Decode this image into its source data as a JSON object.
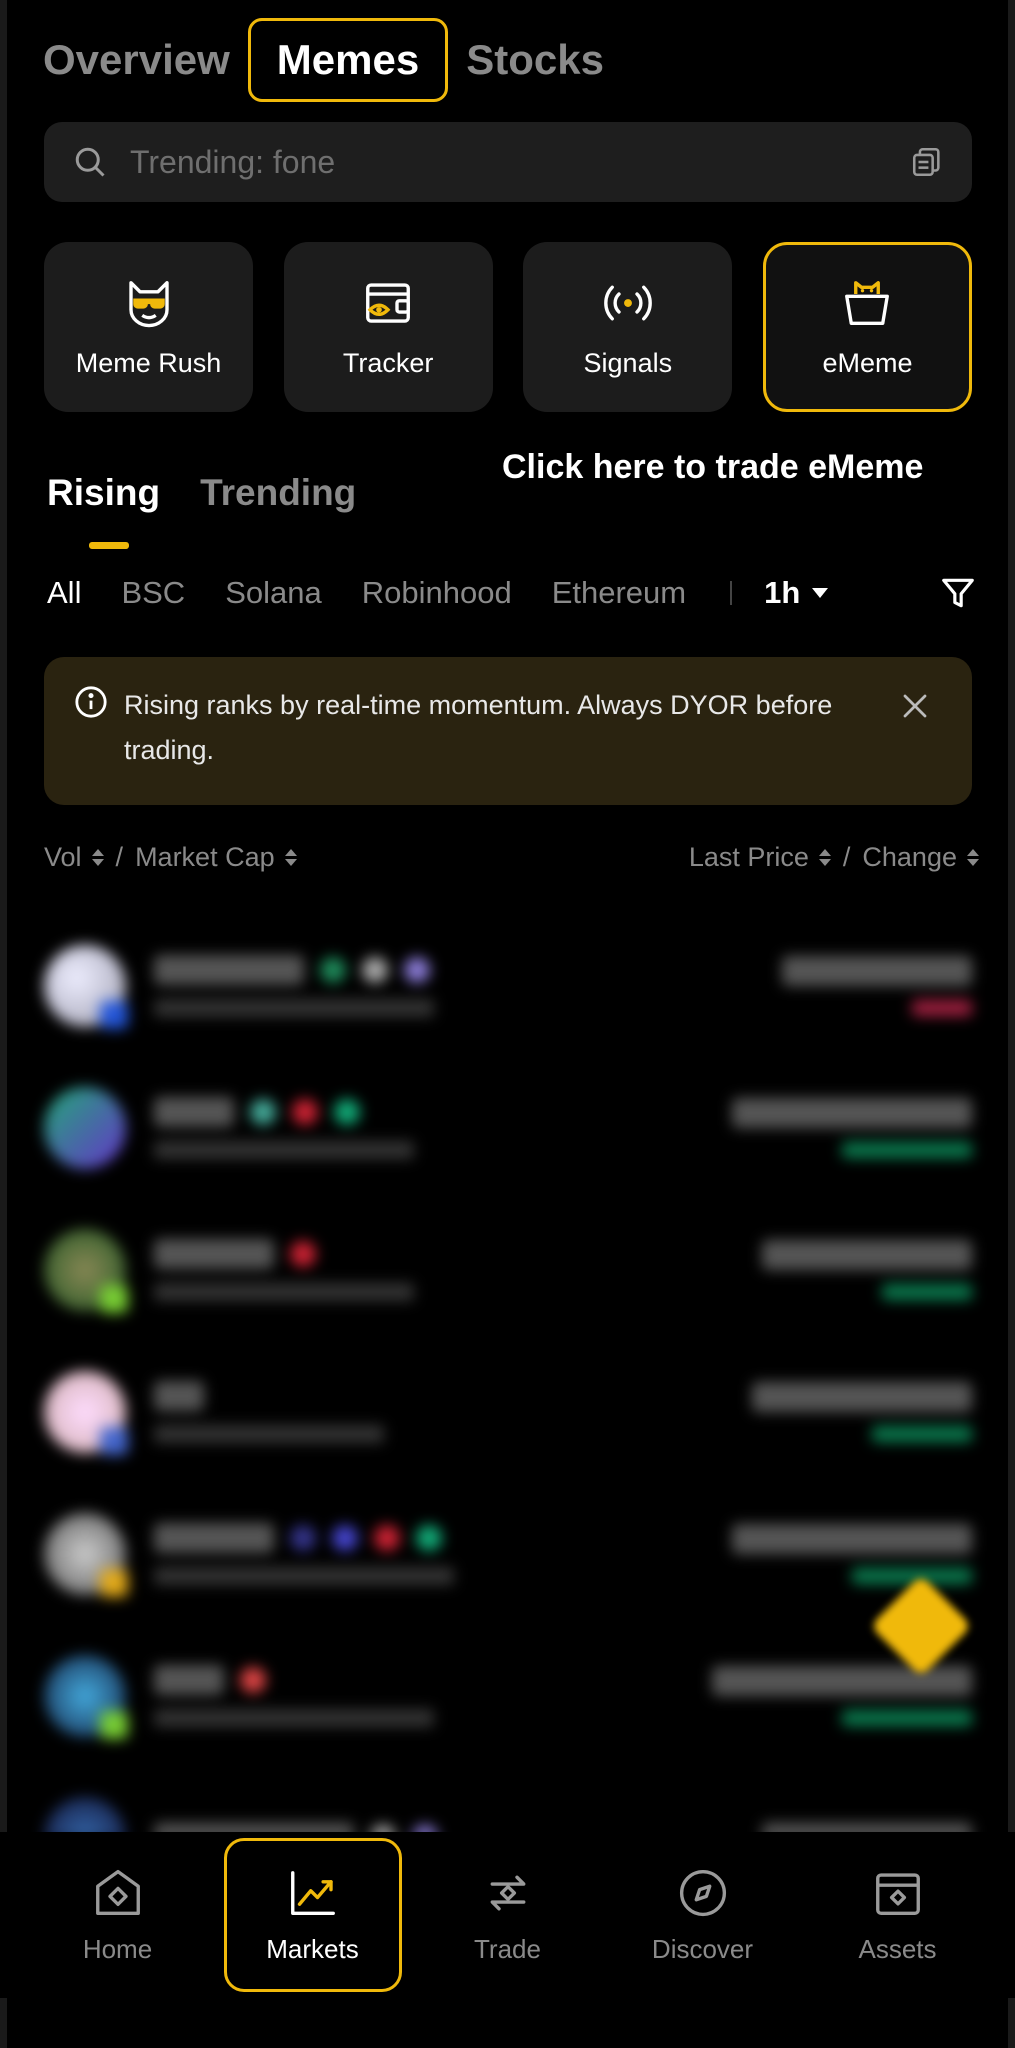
{
  "top_tabs": [
    {
      "label": "Overview",
      "active": false
    },
    {
      "label": "Memes",
      "active": true
    },
    {
      "label": "Stocks",
      "active": false
    }
  ],
  "search": {
    "placeholder": "Trending: fone"
  },
  "shortcuts": [
    {
      "label": "Meme Rush",
      "icon": "cat-sunglasses-icon"
    },
    {
      "label": "Tracker",
      "icon": "wallet-eye-icon"
    },
    {
      "label": "Signals",
      "icon": "broadcast-icon"
    },
    {
      "label": "eMeme",
      "icon": "ememe-cat-icon"
    }
  ],
  "hint": "Click here to trade eMeme",
  "sub_tabs": [
    {
      "label": "Rising",
      "active": true
    },
    {
      "label": "Trending",
      "active": false
    }
  ],
  "chains": [
    "All",
    "BSC",
    "Solana",
    "Robinhood",
    "Ethereum"
  ],
  "timeframe": "1h",
  "notice": "Rising ranks by real-time momentum. Always DYOR before trading.",
  "columns": {
    "vol": "Vol",
    "divider": "/",
    "market_cap": "Market Cap",
    "last_price": "Last Price",
    "change": "Change"
  },
  "colors": {
    "accent": "#f0b90b",
    "up": "#0ecb81",
    "down": "#f6465d"
  },
  "bottom_nav": [
    {
      "label": "Home",
      "icon": "home-icon",
      "active": false
    },
    {
      "label": "Markets",
      "icon": "markets-chart-icon",
      "active": true
    },
    {
      "label": "Trade",
      "icon": "trade-swap-icon",
      "active": false
    },
    {
      "label": "Discover",
      "icon": "compass-icon",
      "active": false
    },
    {
      "label": "Assets",
      "icon": "wallet-icon",
      "active": false
    }
  ]
}
